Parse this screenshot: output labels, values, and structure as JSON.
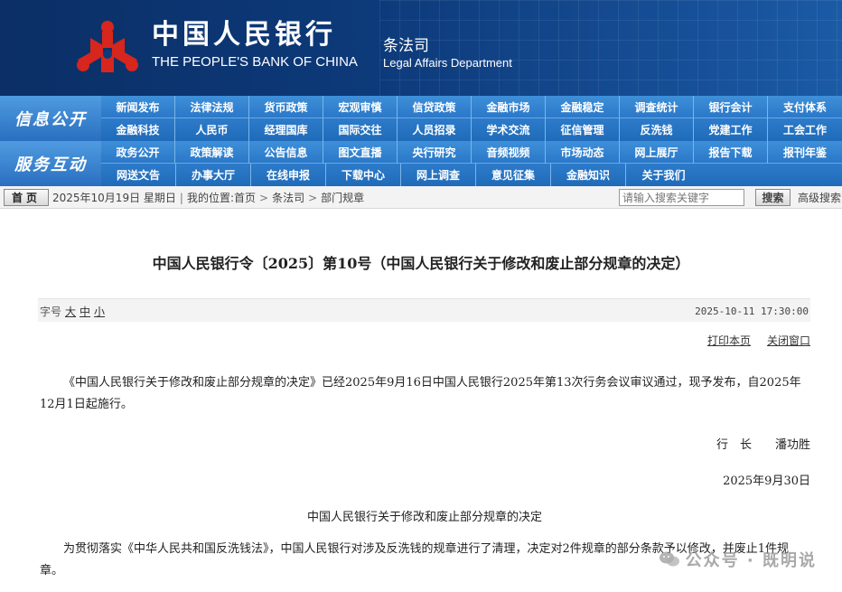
{
  "header": {
    "bank_cn": "中国人民银行",
    "bank_en": "THE PEOPLE'S BANK OF CHINA",
    "dept_cn": "条法司",
    "dept_en": "Legal Affairs Department",
    "logo_icon": "pboc-logo-icon"
  },
  "nav": {
    "section1_title": "信息公开",
    "section1_row1": [
      "新闻发布",
      "法律法规",
      "货币政策",
      "宏观审慎",
      "信贷政策",
      "金融市场",
      "金融稳定",
      "调查统计",
      "银行会计",
      "支付体系"
    ],
    "section1_row2": [
      "金融科技",
      "人民币",
      "经理国库",
      "国际交往",
      "人员招录",
      "学术交流",
      "征信管理",
      "反洗钱",
      "党建工作",
      "工会工作"
    ],
    "section2_title": "服务互动",
    "section2_row1": [
      "政务公开",
      "政策解读",
      "公告信息",
      "图文直播",
      "央行研究",
      "音频视频",
      "市场动态",
      "网上展厅",
      "报告下载",
      "报刊年鉴"
    ],
    "section2_row2": [
      "网送文告",
      "办事大厅",
      "在线申报",
      "下载中心",
      "网上调查",
      "意见征集",
      "金融知识",
      "关于我们"
    ]
  },
  "statusbar": {
    "home_label": "首页",
    "date": "2025年10月19日 星期日",
    "location_label": "我的位置:",
    "crumbs": [
      "首页",
      "条法司",
      "部门规章"
    ],
    "search_placeholder": "请输入搜索关键字",
    "search_button": "搜索",
    "advanced_search": "高级搜索"
  },
  "article": {
    "title": "中国人民银行令〔2025〕第10号（中国人民银行关于修改和废止部分规章的决定）",
    "font_size_label": "字号",
    "font_sizes": [
      "大",
      "中",
      "小"
    ],
    "publish_time": "2025-10-11 17:30:00",
    "print_label": "打印本页",
    "close_label": "关闭窗口",
    "paragraph1": "《中国人民银行关于修改和废止部分规章的决定》已经2025年9月16日中国人民银行2025年第13次行务会议审议通过，现予发布，自2025年12月1日起施行。",
    "signer": "行　长　　潘功胜",
    "sign_date": "2025年9月30日",
    "subtitle": "中国人民银行关于修改和废止部分规章的决定",
    "paragraph2": "为贯彻落实《中华人民共和国反洗钱法》，中国人民银行对涉及反洗钱的规章进行了清理，决定对2件规章的部分条款予以修改，并废止1件规章。"
  },
  "watermark": {
    "icon": "wechat-icon",
    "text": "公众号 · 既明说"
  }
}
